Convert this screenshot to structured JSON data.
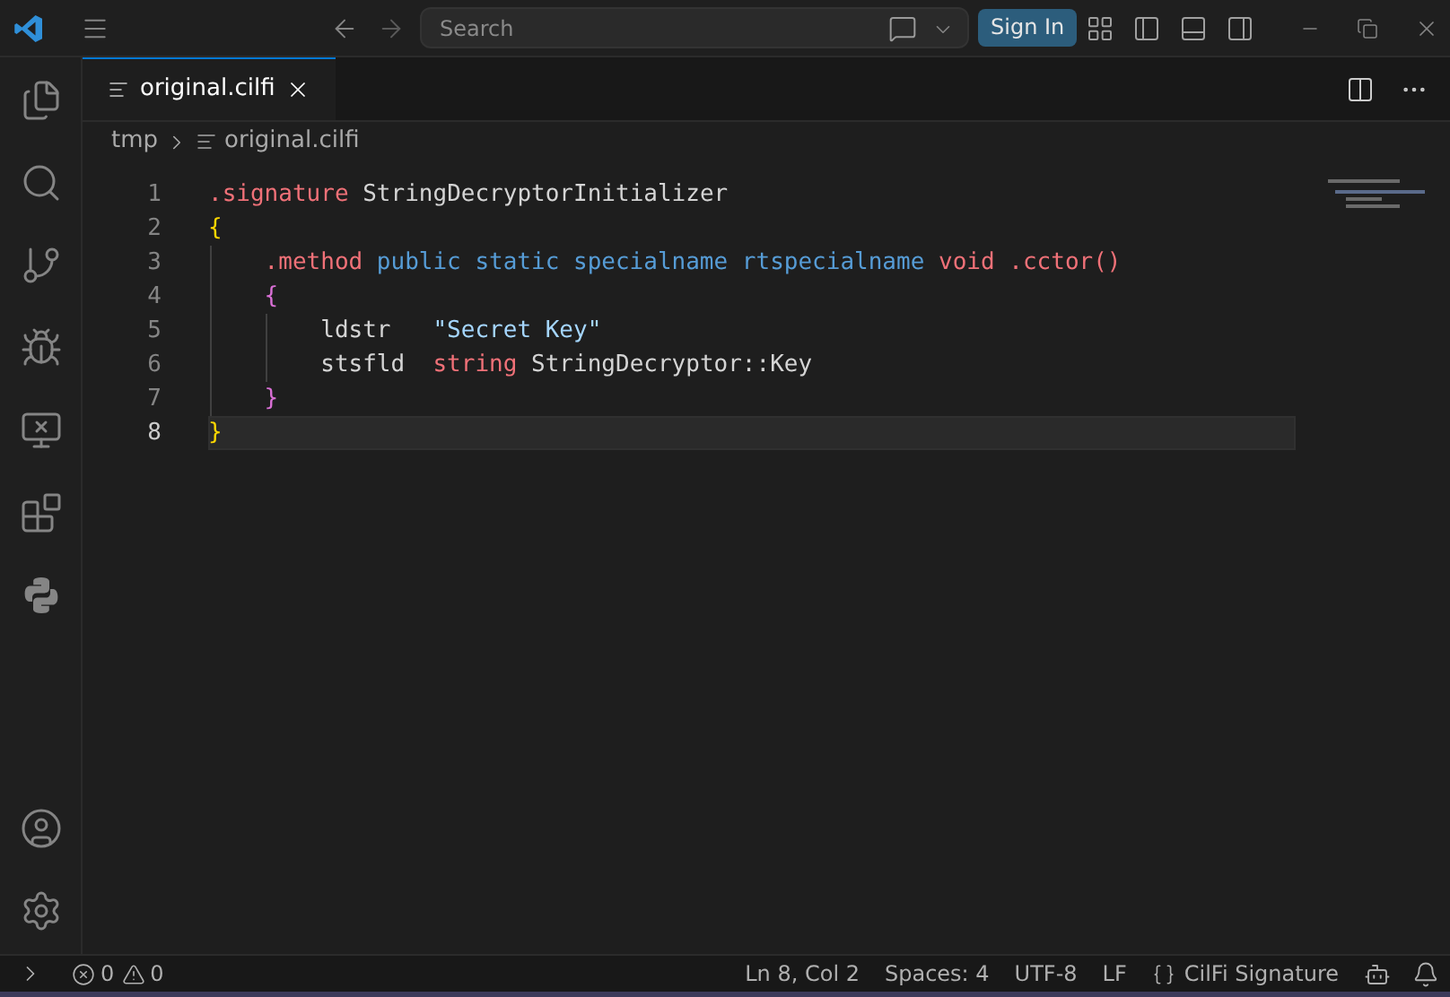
{
  "title_bar": {
    "search": {
      "placeholder": "Search"
    },
    "sign_in": "Sign In"
  },
  "tabs": [
    {
      "label": "original.cilfi",
      "selected": true
    }
  ],
  "breadcrumb": [
    "tmp",
    "original.cilfi"
  ],
  "lines": [
    {
      "number": "1",
      "selected": false,
      "tokens": [
        {
          "text": ".signature",
          "kind": "directive"
        },
        {
          "text": " StringDecryptorInitializer",
          "kind": "plain"
        }
      ]
    },
    {
      "number": "2",
      "selected": false,
      "tokens": [
        {
          "text": "{",
          "kind": "brace1"
        }
      ]
    },
    {
      "number": "3",
      "selected": false,
      "tokens": [
        {
          "text": "    .method",
          "kind": "directive"
        },
        {
          "text": " public static specialname rtspecialname",
          "kind": "keyword"
        },
        {
          "text": " void",
          "kind": "type"
        },
        {
          "text": " .cctor",
          "kind": "directive"
        },
        {
          "text": "()",
          "kind": "brace3"
        }
      ]
    },
    {
      "number": "4",
      "selected": false,
      "tokens": [
        {
          "text": "    {",
          "kind": "brace2"
        }
      ]
    },
    {
      "number": "5",
      "selected": false,
      "tokens": [
        {
          "text": "        ldstr   ",
          "kind": "plain"
        },
        {
          "text": "\"Secret Key\"",
          "kind": "string"
        }
      ]
    },
    {
      "number": "6",
      "selected": false,
      "tokens": [
        {
          "text": "        stsfld  ",
          "kind": "plain"
        },
        {
          "text": "string",
          "kind": "type"
        },
        {
          "text": " StringDecryptor::Key",
          "kind": "plain"
        }
      ]
    },
    {
      "number": "7",
      "selected": false,
      "tokens": [
        {
          "text": "    }",
          "kind": "brace2"
        }
      ]
    },
    {
      "number": "8",
      "selected": true,
      "tokens": [
        {
          "text": "}",
          "kind": "brace1"
        }
      ]
    }
  ],
  "status_bar": {
    "errors": "0",
    "warnings": "0",
    "position": "Ln 8, Col 2",
    "spaces": "Spaces: 4",
    "encoding": "UTF-8",
    "eol": "LF",
    "language": "CilFi Signature"
  }
}
